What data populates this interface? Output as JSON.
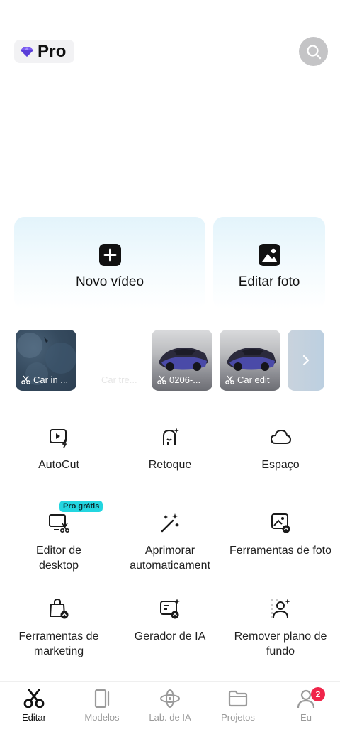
{
  "header": {
    "pro_label": "Pro"
  },
  "actions": {
    "new_video": "Novo vídeo",
    "edit_photo": "Editar foto"
  },
  "projects": [
    {
      "caption": "Car in ..."
    },
    {
      "caption": "Car tre..."
    },
    {
      "caption": "0206-..."
    },
    {
      "caption": "Car edit"
    }
  ],
  "tools": [
    {
      "label": "AutoCut"
    },
    {
      "label": "Retoque"
    },
    {
      "label": "Espaço"
    },
    {
      "label": "Editor de desktop",
      "tag": "Pro grátis"
    },
    {
      "label": "Aprimorar automaticament"
    },
    {
      "label": "Ferramentas de foto"
    },
    {
      "label": "Ferramentas de marketing"
    },
    {
      "label": "Gerador de IA"
    },
    {
      "label": "Remover plano de fundo"
    }
  ],
  "nav": [
    {
      "label": "Editar",
      "active": true
    },
    {
      "label": "Modelos"
    },
    {
      "label": "Lab. de IA"
    },
    {
      "label": "Projetos"
    },
    {
      "label": "Eu",
      "badge": "2"
    }
  ],
  "colors": {
    "accent_tag": "#23d6e0",
    "badge": "#f0254a",
    "gem": "#7b5cf0"
  }
}
